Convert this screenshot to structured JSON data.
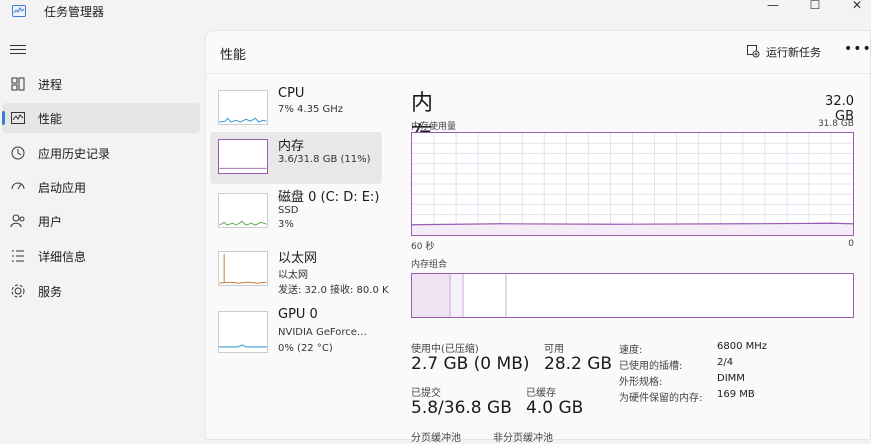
{
  "app": {
    "title": "任务管理器"
  },
  "window_controls": {
    "minimize": "—",
    "maximize": "☐",
    "close": "✕"
  },
  "sidebar": {
    "items": [
      {
        "label": "进程",
        "icon": "process-icon"
      },
      {
        "label": "性能",
        "icon": "performance-icon",
        "active": true
      },
      {
        "label": "应用历史记录",
        "icon": "history-icon"
      },
      {
        "label": "启动应用",
        "icon": "startup-icon"
      },
      {
        "label": "用户",
        "icon": "users-icon"
      },
      {
        "label": "详细信息",
        "icon": "details-icon"
      },
      {
        "label": "服务",
        "icon": "services-icon"
      }
    ]
  },
  "header": {
    "title": "性能",
    "run_task": "运行新任务",
    "more": "•••"
  },
  "devices": [
    {
      "title": "CPU",
      "sub1": "7% 4.35 GHz",
      "sub2": "",
      "sub3": ""
    },
    {
      "title": "内存",
      "sub1": "3.6/31.8 GB (11%)",
      "sub2": "",
      "sub3": ""
    },
    {
      "title": "磁盘 0 (C: D: E:)",
      "sub1": "SSD",
      "sub2": "3%",
      "sub3": ""
    },
    {
      "title": "以太网",
      "sub1": "以太网",
      "sub2": "发送: 32.0 接收: 80.0 K",
      "sub3": ""
    },
    {
      "title": "GPU 0",
      "sub1": "NVIDIA GeForce…",
      "sub2": "0% (22 °C)",
      "sub3": ""
    }
  ],
  "memory": {
    "title": "内存",
    "total": "32.0 GB",
    "usage_label": "内存使用量",
    "usage_max": "31.8 GB",
    "usage_fraction": 0.11,
    "time_left": "60 秒",
    "time_right": "0",
    "composition_label": "内存组合",
    "stats": {
      "in_use_label": "使用中(已压缩)",
      "in_use_value": "2.7 GB (0 MB)",
      "available_label": "可用",
      "available_value": "28.2 GB",
      "committed_label": "已提交",
      "committed_value": "5.8/36.8 GB",
      "cached_label": "已缓存",
      "cached_value": "4.0 GB",
      "paged_label": "分页缓冲池",
      "nonpaged_label": "非分页缓冲池"
    },
    "details": [
      {
        "key": "速度:",
        "value": "6800 MHz"
      },
      {
        "key": "已使用的插槽:",
        "value": "2/4"
      },
      {
        "key": "外形规格:",
        "value": "DIMM"
      },
      {
        "key": "为硬件保留的内存:",
        "value": "169 MB"
      }
    ]
  },
  "colors": {
    "accent": "#3a7bd5",
    "memory": "#9c5bb2",
    "cpu": "#2a8fd0",
    "disk": "#4fa83d",
    "ethernet": "#c2752d"
  }
}
